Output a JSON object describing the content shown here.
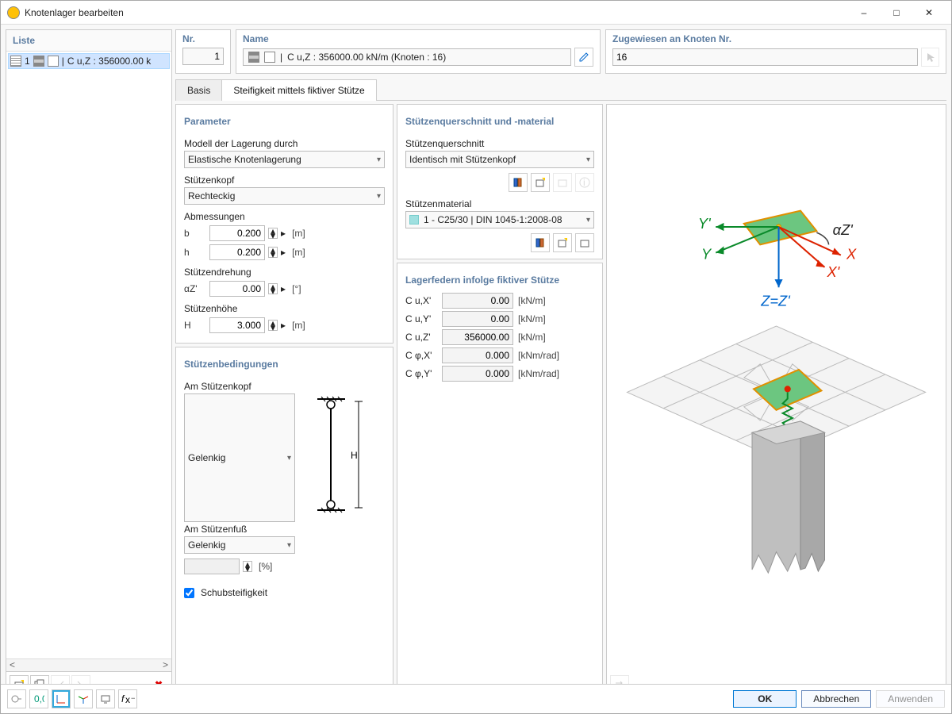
{
  "window": {
    "title": "Knotenlager bearbeiten"
  },
  "list": {
    "header": "Liste",
    "items": [
      {
        "num": "1",
        "desc": "C u,Z : 356000.00 k"
      }
    ]
  },
  "top": {
    "nr_label": "Nr.",
    "nr_value": "1",
    "name_label": "Name",
    "name_value": "C u,Z : 356000.00 kN/m (Knoten : 16)",
    "assigned_label": "Zugewiesen an Knoten Nr.",
    "assigned_value": "16"
  },
  "tabs": {
    "basis": "Basis",
    "stiff": "Steifigkeit mittels fiktiver Stütze"
  },
  "parameter": {
    "header": "Parameter",
    "model_label": "Modell der Lagerung durch",
    "model_value": "Elastische Knotenlagerung",
    "head_label": "Stützenkopf",
    "head_value": "Rechteckig",
    "dims_label": "Abmessungen",
    "b": {
      "sym": "b",
      "val": "0.200",
      "unit": "[m]"
    },
    "h": {
      "sym": "h",
      "val": "0.200",
      "unit": "[m]"
    },
    "rotation_label": "Stützendrehung",
    "alpha": {
      "sym": "αZ'",
      "val": "0.00",
      "unit": "[°]"
    },
    "height_label": "Stützenhöhe",
    "H": {
      "sym": "H",
      "val": "3.000",
      "unit": "[m]"
    }
  },
  "conditions": {
    "header": "Stützenbedingungen",
    "top_label": "Am Stützenkopf",
    "top_value": "Gelenkig",
    "bot_label": "Am Stützenfuß",
    "bot_value": "Gelenkig",
    "pct_unit": "[%]",
    "shear": "Schubsteifigkeit",
    "columnH": "H"
  },
  "section": {
    "header": "Stützenquerschnitt und -material",
    "cs_label": "Stützenquerschnitt",
    "cs_value": "Identisch mit Stützenkopf",
    "mat_label": "Stützenmaterial",
    "mat_value": "1 - C25/30 | DIN 1045-1:2008-08"
  },
  "springs": {
    "header": "Lagerfedern infolge fiktiver Stütze",
    "rows": [
      {
        "sym": "C u,X'",
        "val": "0.00",
        "unit": "[kN/m]"
      },
      {
        "sym": "C u,Y'",
        "val": "0.00",
        "unit": "[kN/m]"
      },
      {
        "sym": "C u,Z'",
        "val": "356000.00",
        "unit": "[kN/m]"
      },
      {
        "sym": "C φ,X'",
        "val": "0.000",
        "unit": "[kNm/rad]"
      },
      {
        "sym": "C φ,Y'",
        "val": "0.000",
        "unit": "[kNm/rad]"
      }
    ]
  },
  "axes": {
    "X": "X",
    "Xp": "X'",
    "Y": "Y",
    "Yp": "Y'",
    "ZZ": "Z=Z'",
    "alpha": "αZ'"
  },
  "buttons": {
    "ok": "OK",
    "cancel": "Abbrechen",
    "apply": "Anwenden"
  }
}
